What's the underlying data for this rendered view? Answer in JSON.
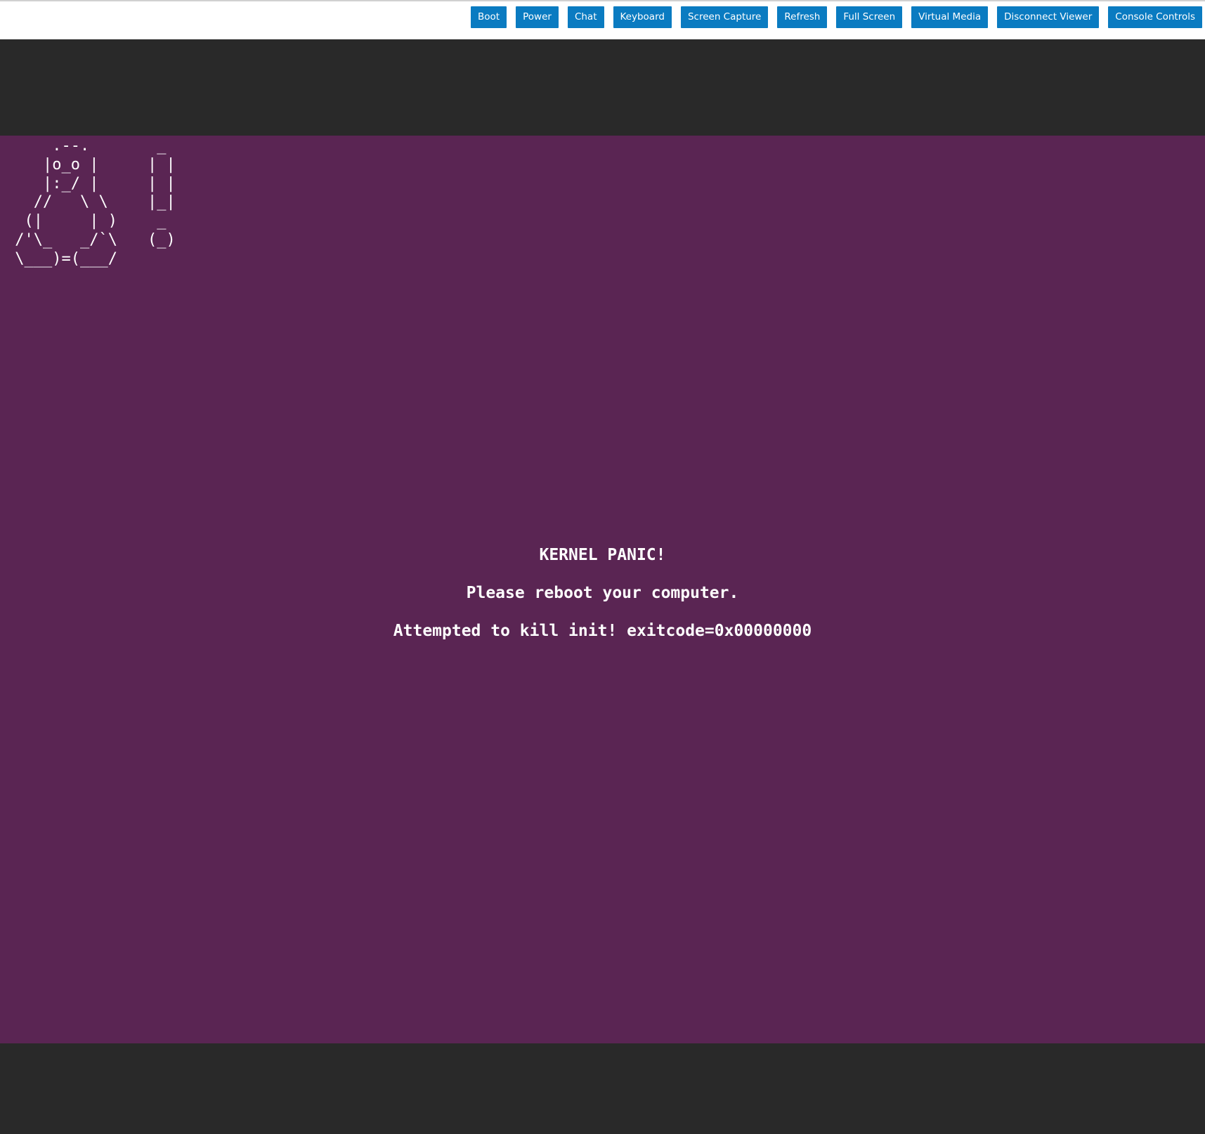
{
  "toolbar": {
    "buttons": [
      {
        "label": "Boot"
      },
      {
        "label": "Power"
      },
      {
        "label": "Chat"
      },
      {
        "label": "Keyboard"
      },
      {
        "label": "Screen Capture"
      },
      {
        "label": "Refresh"
      },
      {
        "label": "Full Screen"
      },
      {
        "label": "Virtual Media"
      },
      {
        "label": "Disconnect Viewer"
      },
      {
        "label": "Console Controls"
      }
    ],
    "button_color": "#0a7bc1"
  },
  "console": {
    "background_color": "#5a2553",
    "ascii_tux": "     .--.\n    |o_o |\n    |:_/ |\n   //   \\ \\\n  (|     | )\n /'\\_   _/`\\\n \\___)=(___/",
    "ascii_exclaim": " _\n| |\n| |\n|_|\n _\n(_)",
    "title": "KERNEL PANIC!",
    "message": "Please reboot your computer.",
    "detail": "Attempted to kill init! exitcode=0x00000000"
  }
}
